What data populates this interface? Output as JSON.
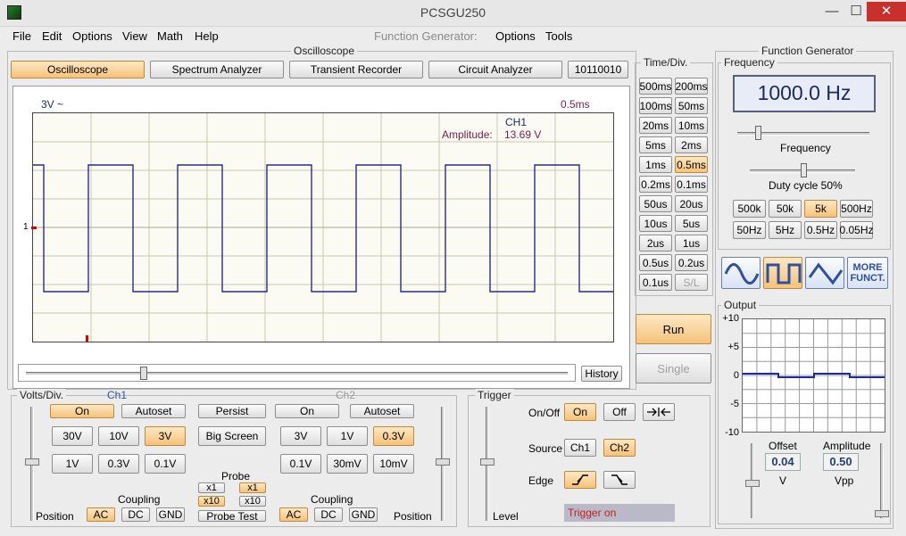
{
  "window": {
    "title": "PCSGU250",
    "minimize": "—",
    "maximize": "☐",
    "close": "✕"
  },
  "menu": {
    "file": "File",
    "edit": "Edit",
    "options": "Options",
    "view": "View",
    "math": "Math",
    "help": "Help",
    "fg_label": "Function Generator:",
    "fg_options": "Options",
    "fg_tools": "Tools"
  },
  "osc": {
    "group_title": "Oscilloscope",
    "tabs": {
      "oscilloscope": "Oscilloscope",
      "spectrum": "Spectrum Analyzer",
      "transient": "Transient Recorder",
      "circuit": "Circuit Analyzer",
      "binary": "10110010"
    },
    "screen": {
      "ch_range": "3V ~",
      "timebase": "0.5ms",
      "ch_name": "CH1",
      "amp_label": "Amplitude:",
      "amp_value": "13.69 V",
      "marker": "1",
      "history": "History",
      "trace_color": "#2a2a8c"
    }
  },
  "timediv": {
    "title": "Time/Div.",
    "buttons": [
      "500ms",
      "200ms",
      "100ms",
      "50ms",
      "20ms",
      "10ms",
      "5ms",
      "2ms",
      "1ms",
      "0.5ms",
      "0.2ms",
      "0.1ms",
      "50us",
      "20us",
      "10us",
      "5us",
      "2us",
      "1us",
      "0.5us",
      "0.2us",
      "0.1us",
      "S/L"
    ],
    "selected": "0.5ms",
    "run": "Run",
    "single": "Single"
  },
  "volts": {
    "title": "Volts/Div.",
    "ch1": "Ch1",
    "ch2": "Ch2",
    "ch1_on": "On",
    "ch1_autoset": "Autoset",
    "persist": "Persist",
    "ch2_on": "On",
    "ch2_autoset": "Autoset",
    "ch1_30v": "30V",
    "ch1_10v": "10V",
    "ch1_3v": "3V",
    "big_screen": "Big Screen",
    "ch2_3v": "3V",
    "ch2_1v": "1V",
    "ch2_03v": "0.3V",
    "ch1_1v": "1V",
    "ch1_03v": "0.3V",
    "ch1_01v": "0.1V",
    "ch2_01v": "0.1V",
    "ch2_30mv": "30mV",
    "ch2_10mv": "10mV",
    "probe": "Probe",
    "x1": "x1",
    "x10": "x10",
    "probe_test": "Probe Test",
    "coupling": "Coupling",
    "ac": "AC",
    "dc": "DC",
    "gnd": "GND",
    "position": "Position"
  },
  "trigger": {
    "title": "Trigger",
    "onoff": "On/Off",
    "on": "On",
    "off": "Off",
    "source": "Source",
    "ch1": "Ch1",
    "ch2": "Ch2",
    "edge": "Edge",
    "level": "Level",
    "status": "Trigger on"
  },
  "fg": {
    "title": "Function Generator",
    "freq_title": "Frequency",
    "freq_value": "1000.0 Hz",
    "freq_label": "Frequency",
    "duty": "Duty cycle 50%",
    "ranges": [
      "500k",
      "50k",
      "5k",
      "500Hz",
      "50Hz",
      "5Hz",
      "0.5Hz",
      "0.05Hz"
    ],
    "range_selected": "5k",
    "more1": "MORE",
    "more2": "FUNCT.",
    "output_title": "Output",
    "y_ticks": [
      "+10",
      "+5",
      "0",
      "-5",
      "-10"
    ],
    "offset_label": "Offset",
    "offset_value": "0.04",
    "offset_unit": "V",
    "amp_label": "Amplitude",
    "amp_value": "0.50",
    "amp_unit": "Vpp"
  }
}
